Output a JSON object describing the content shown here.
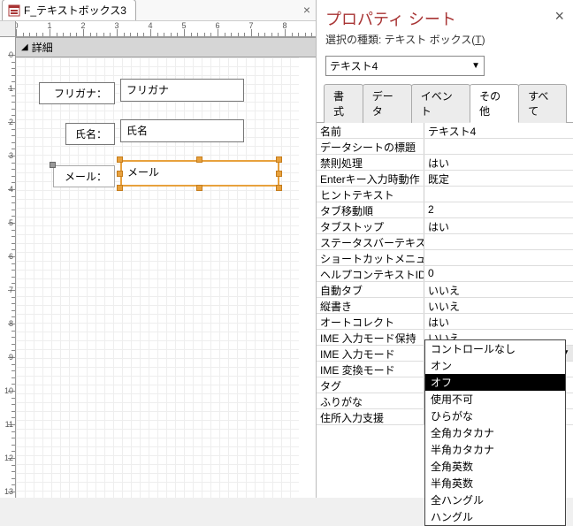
{
  "form": {
    "tab_title": "F_テキストボックス3",
    "section_label": "詳細",
    "fields": [
      {
        "label": "フリガナ：",
        "text": "フリガナ"
      },
      {
        "label": "氏名：",
        "text": "氏名"
      },
      {
        "label": "メール：",
        "text": "メール"
      }
    ],
    "ruler_h_max": 8,
    "ruler_v_max": 13
  },
  "prop": {
    "title": "プロパティ シート",
    "subtitle_prefix": "選択の種類: ",
    "subtitle_type": "テキスト ボックス(",
    "subtitle_accel": "T",
    "subtitle_suffix": ")",
    "object_name": "テキスト4",
    "tabs": [
      "書式",
      "データ",
      "イベント",
      "その他",
      "すべて"
    ],
    "active_tab": 3,
    "rows": [
      {
        "k": "名前",
        "v": "テキスト4"
      },
      {
        "k": "データシートの標題",
        "v": ""
      },
      {
        "k": "禁則処理",
        "v": "はい"
      },
      {
        "k": "Enterキー入力時動作",
        "v": "既定"
      },
      {
        "k": "ヒントテキスト",
        "v": ""
      },
      {
        "k": "タブ移動順",
        "v": "2"
      },
      {
        "k": "タブストップ",
        "v": "はい"
      },
      {
        "k": "ステータスバーテキスト",
        "v": ""
      },
      {
        "k": "ショートカットメニューバー",
        "v": ""
      },
      {
        "k": "ヘルプコンテキストID",
        "v": "0"
      },
      {
        "k": "自動タブ",
        "v": "いいえ"
      },
      {
        "k": "縦書き",
        "v": "いいえ"
      },
      {
        "k": "オートコレクト",
        "v": "はい"
      },
      {
        "k": "IME 入力モード保持",
        "v": "いいえ"
      },
      {
        "k": "IME 入力モード",
        "v": "オン",
        "active": true
      },
      {
        "k": "IME 変換モード",
        "v": ""
      },
      {
        "k": "タグ",
        "v": ""
      },
      {
        "k": "ふりがな",
        "v": ""
      },
      {
        "k": "住所入力支援",
        "v": ""
      }
    ],
    "dropdown": {
      "items": [
        "コントロールなし",
        "オン",
        "オフ",
        "使用不可",
        "ひらがな",
        "全角カタカナ",
        "半角カタカナ",
        "全角英数",
        "半角英数",
        "全ハングル",
        "ハングル"
      ],
      "selected": 2
    }
  }
}
